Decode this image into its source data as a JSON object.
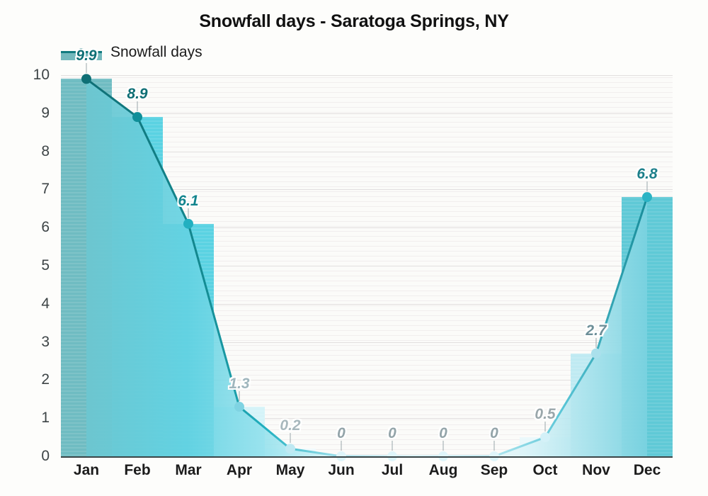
{
  "chart_data": {
    "type": "bar",
    "title": "Snowfall days - Saratoga Springs, NY",
    "xlabel": "",
    "ylabel": "",
    "categories": [
      "Jan",
      "Feb",
      "Mar",
      "Apr",
      "May",
      "Jun",
      "Jul",
      "Aug",
      "Sep",
      "Oct",
      "Nov",
      "Dec"
    ],
    "values": [
      9.9,
      8.9,
      6.1,
      1.3,
      0.2,
      0,
      0,
      0,
      0,
      0.5,
      2.7,
      6.8
    ],
    "value_labels": [
      "9.9",
      "8.9",
      "6.1",
      "1.3",
      "0.2",
      "0",
      "0",
      "0",
      "0",
      "0.5",
      "2.7",
      "6.8"
    ],
    "series": [
      {
        "name": "Snowfall days",
        "values": [
          9.9,
          8.9,
          6.1,
          1.3,
          0.2,
          0,
          0,
          0,
          0,
          0.5,
          2.7,
          6.8
        ]
      }
    ],
    "legend": [
      "Snowfall days"
    ],
    "legend_position": "top-left",
    "ylim": [
      0,
      10
    ],
    "yticks": [
      "0",
      "1",
      "2",
      "3",
      "4",
      "5",
      "6",
      "7",
      "8",
      "9",
      "10"
    ],
    "grid": true,
    "bar_colors": [
      "#6fbcc2",
      "#5ad2e2",
      "#5ad2e2",
      "#d4f3f8",
      "#eefafd",
      "#f6fcfe",
      "#f6fcfe",
      "#f6fcfe",
      "#f6fcfe",
      "#eaf8fb",
      "#bfeaf2",
      "#5fc9d6"
    ],
    "label_colors": [
      "#0f6f75",
      "#0f6f75",
      "#12848d",
      "#9fb6bd",
      "#a8b8bd",
      "#93a4a9",
      "#93a4a9",
      "#93a4a9",
      "#93a4a9",
      "#9aa7ab",
      "#6d8f98",
      "#1c7f8a"
    ]
  },
  "style": {
    "line_color_start": "#0f6f75",
    "line_color_end": "#22b8cf",
    "marker_color_start": "#0f6f75",
    "marker_color_end": "#cfeef6",
    "area_fill_top": "#7fd4e0",
    "area_fill_bottom": "#f3fcfe",
    "background": "#fdfdfb",
    "axis_color": "#3b4547",
    "grid_color": "#e2dfdf",
    "title_color": "#111111"
  },
  "legend": {
    "label": "Snowfall days"
  }
}
